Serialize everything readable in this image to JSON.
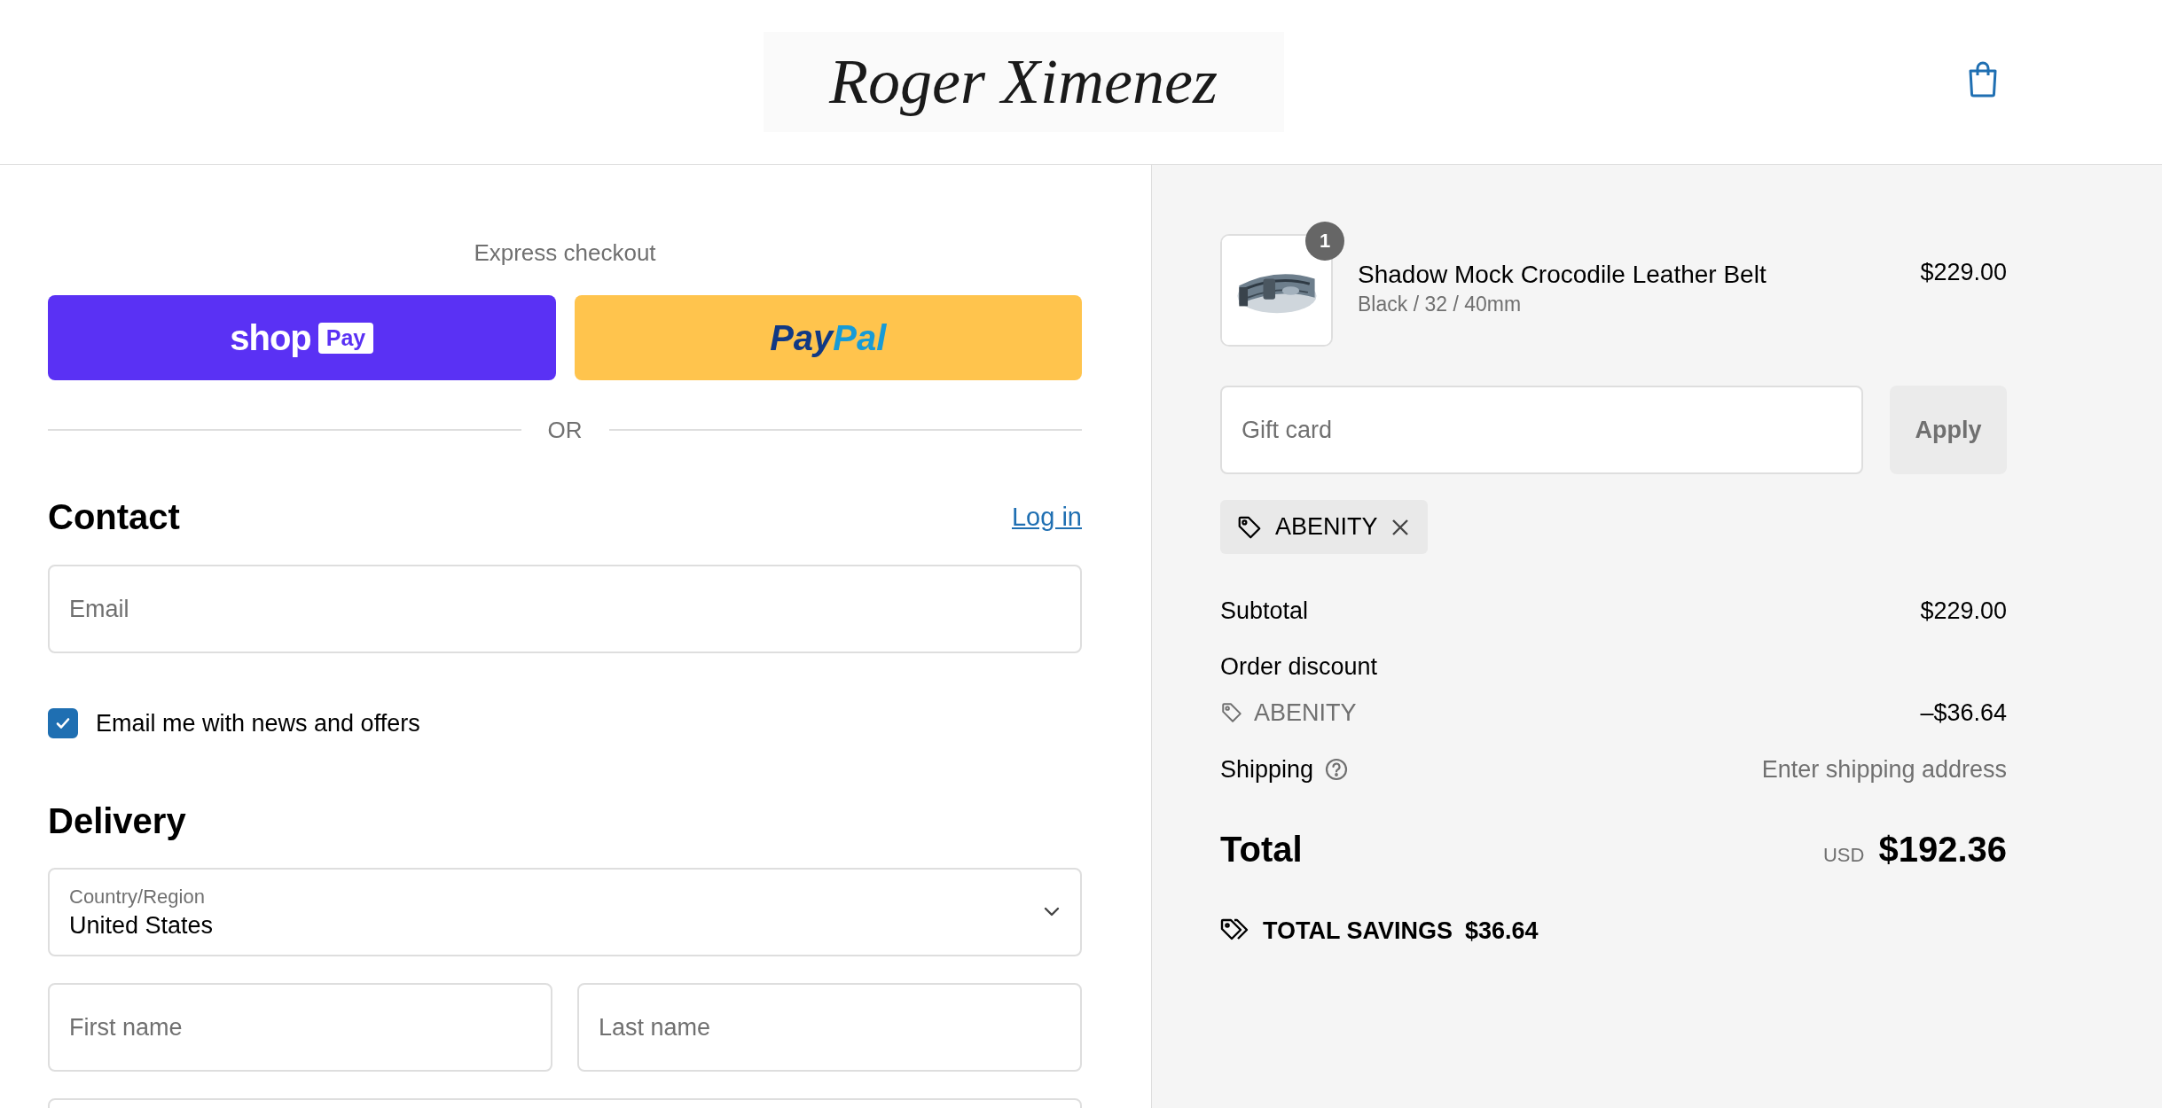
{
  "header": {
    "logo": "Roger Ximenez"
  },
  "express_checkout": {
    "title": "Express checkout",
    "buttons": [
      {
        "kind": "shop_pay",
        "text": "shop",
        "badge": "Pay"
      },
      {
        "kind": "paypal",
        "text": "Pay",
        "text_2": "Pal"
      }
    ],
    "divider": "OR"
  },
  "contact": {
    "heading": "Contact",
    "link": "Log in",
    "email": {
      "placeholder": "Email"
    },
    "newsletter": {
      "label": "Email me with news and offers",
      "checked": true
    }
  },
  "delivery": {
    "heading": "Delivery",
    "country": {
      "label": "Country/Region",
      "value": "United States"
    },
    "fields": [
      {
        "placeholder": "First name"
      },
      {
        "placeholder": "Last name"
      }
    ]
  },
  "order": {
    "items": [
      {
        "quantity": "1",
        "name": "Shadow Mock Crocodile Leather Belt",
        "variant": "Black / 32 / 40mm",
        "price": "$229.00"
      }
    ],
    "gift_card": {
      "placeholder": "Gift card",
      "button": "Apply"
    },
    "applied_codes": [
      {
        "code": "ABENITY"
      }
    ],
    "summary": {
      "subtotal": {
        "label": "Subtotal",
        "value": "$229.00"
      },
      "discount": {
        "label": "Order discount",
        "code": "ABENITY",
        "value": "–$36.64"
      },
      "shipping": {
        "label": "Shipping",
        "value": "Enter shipping address"
      },
      "total": {
        "label": "Total",
        "currency": "USD",
        "value": "$192.36"
      },
      "savings": {
        "label": "TOTAL SAVINGS",
        "value": "$36.64"
      }
    }
  }
}
